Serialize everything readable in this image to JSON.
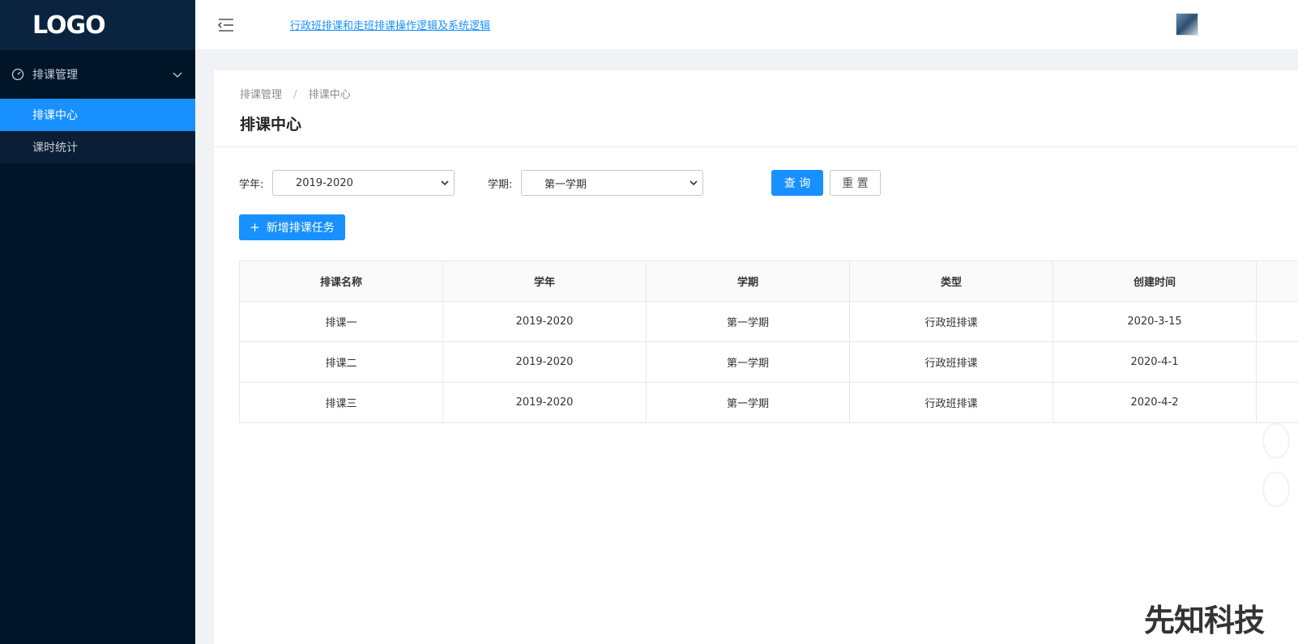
{
  "sidebar": {
    "logo": "LOGO",
    "menu_group": {
      "label": "排课管理",
      "icon": "gauge-icon"
    },
    "items": [
      {
        "label": "排课中心",
        "active": true
      },
      {
        "label": "课时统计",
        "active": false
      }
    ]
  },
  "header": {
    "menu_icon": "menu-fold-icon",
    "link_text": "行政班排课和走班排课操作逻辑及系统逻辑"
  },
  "breadcrumb": {
    "root": "排课管理",
    "separator": "/",
    "current": "排课中心"
  },
  "page_title": "排课中心",
  "filters": {
    "year_label": "学年:",
    "year_value": "2019-2020",
    "term_label": "学期:",
    "term_value": "第一学期",
    "query_button": "查 询",
    "reset_button": "重 置"
  },
  "add_button": {
    "icon": "+",
    "label": "新增排课任务"
  },
  "table": {
    "columns": [
      "排课名称",
      "学年",
      "学期",
      "类型",
      "创建时间"
    ],
    "rows": [
      [
        "排课一",
        "2019-2020",
        "第一学期",
        "行政班排课",
        "2020-3-15"
      ],
      [
        "排课二",
        "2019-2020",
        "第一学期",
        "行政班排课",
        "2020-4-1"
      ],
      [
        "排课三",
        "2019-2020",
        "第一学期",
        "行政班排课",
        "2020-4-2"
      ]
    ]
  },
  "watermark": "先知科技",
  "colors": {
    "primary": "#1890ff",
    "sidebar": "#011529"
  }
}
